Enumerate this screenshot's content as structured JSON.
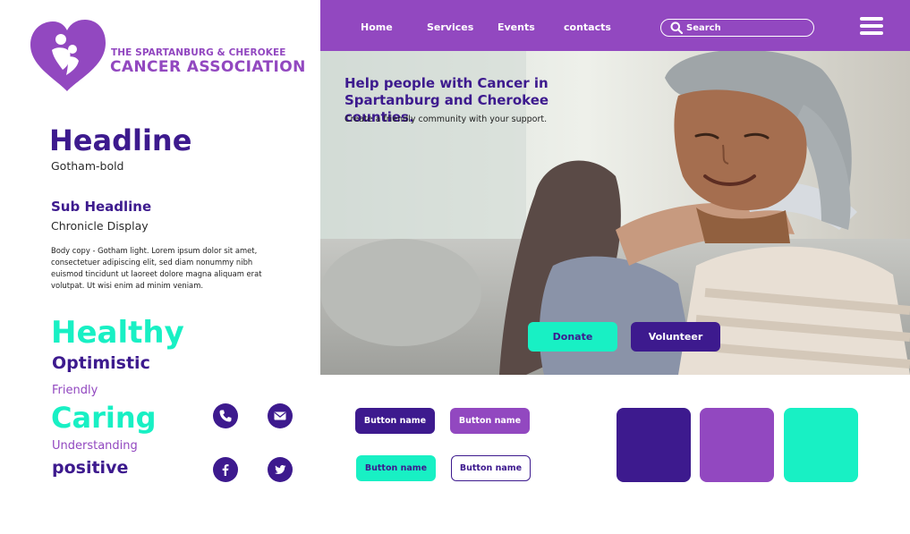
{
  "logo": {
    "line1": "THE SPARTANBURG & CHEROKEE",
    "line2": "CANCER ASSOCIATION"
  },
  "typography": {
    "headline": "Headline",
    "headline_font": "Gotham-bold",
    "subheadline": "Sub Headline",
    "subheadline_font": "Chronicle Display",
    "body_copy": "Body copy - Gotham light. Lorem ipsum dolor sit amet, consectetuer adipiscing elit, sed diam nonummy nibh euismod tincidunt ut laoreet dolore magna aliquam erat volutpat. Ut wisi enim ad minim veniam."
  },
  "brand_words": [
    "Healthy",
    "Optimistic",
    "Friendly",
    "Caring",
    "Understanding",
    "positive"
  ],
  "social_icons": [
    "phone-icon",
    "email-icon",
    "facebook-icon",
    "twitter-icon"
  ],
  "nav": {
    "links": [
      "Home",
      "Services",
      "Events",
      "contacts"
    ],
    "search_placeholder": "Search"
  },
  "hero": {
    "title": "Help people with Cancer in Spartanburg and Cherokee counties.",
    "subtitle": "Create a friendly community with your support.",
    "donate_label": "Donate",
    "volunteer_label": "Volunteer"
  },
  "sample_buttons": [
    "Button name",
    "Button name",
    "Button name",
    "Button name"
  ],
  "colors": {
    "dark_purple": "#3d1a8e",
    "purple": "#9248c0",
    "teal": "#18f0c4",
    "white": "#ffffff"
  }
}
